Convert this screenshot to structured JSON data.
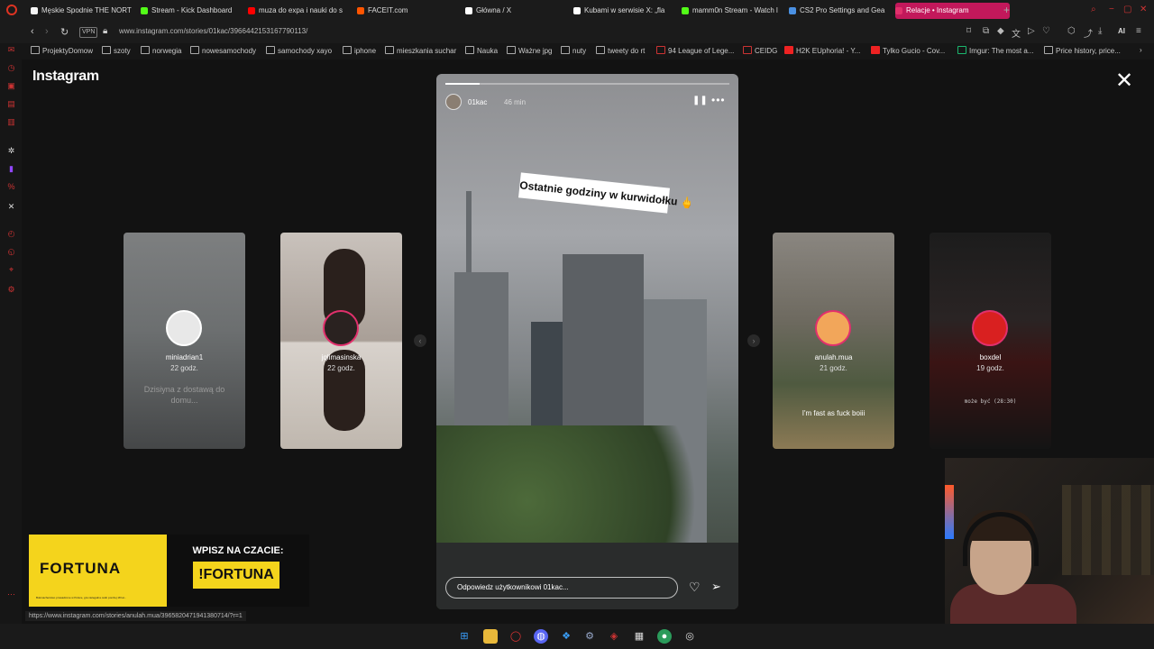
{
  "browser": {
    "tabs": [
      {
        "label": "Męskie Spodnie THE NORT",
        "color": "#f5f5f5"
      },
      {
        "label": "Stream - Kick Dashboard",
        "color": "#53fc18"
      },
      {
        "label": "muza do expa i nauki do s",
        "color": "#ff0000"
      },
      {
        "label": "FACEIT.com",
        "color": "#ff5500"
      },
      {
        "label": "Główna / X",
        "color": "#ffffff"
      },
      {
        "label": "Kubami w serwisie X: „fla",
        "color": "#ffffff"
      },
      {
        "label": "mamm0n Stream - Watch l",
        "color": "#53fc18"
      },
      {
        "label": "CS2 Pro Settings and Gea",
        "color": "#4a90e2"
      },
      {
        "label": "Relacje • Instagram",
        "color": "#e1306c"
      }
    ],
    "new_tab": "+",
    "url": "www.instagram.com/stories/01kac/3966442153167790113/",
    "vpn": "VPN",
    "ai": "AI",
    "bookmarks": [
      "ProjektyDomow",
      "szoty",
      "norwegia",
      "nowesamochody",
      "samochody xayo",
      "iphone",
      "mieszkania suchar",
      "Nauka",
      "Ważne jpg",
      "nuty",
      "tweety do rt",
      "94 League of Lege...",
      "CEIDG",
      "H2K EUphoria! - Y...",
      "Tylko Gucio - Cov...",
      "Imgur: The most a...",
      "Price history, price..."
    ]
  },
  "instagram": {
    "logo": "Instagram",
    "story": {
      "username": "01kac",
      "time": "46 min",
      "sticker_text": "Ostatnie godziny w kurwidołku 🖕",
      "reply_placeholder": "Odpowiedz użytkownikowi 01kac...",
      "progress": 0.12
    },
    "previews": [
      {
        "name": "miniadrian1",
        "time": "22 godz.",
        "caption": "Dzisiyna z dostawą do domu...",
        "avatar_color": "#e8e8e8"
      },
      {
        "name": "jqlimasinska",
        "time": "22 godz.",
        "caption": "",
        "avatar_color": "#2a2220"
      },
      {
        "name": "anulah.mua",
        "time": "21 godz.",
        "caption": "I'm fast as fuck boiii",
        "avatar_color": "#f2a65a"
      },
      {
        "name": "boxdel",
        "time": "19 godz.",
        "caption": "może być (28:30)",
        "avatar_color": "#d92020"
      }
    ]
  },
  "overlay": {
    "brand": "FORTUNA",
    "banner_title": "WPISZ NA CZACIE:",
    "banner_command": "!FORTUNA",
    "small_print": "Bukmacherstwo prowadzone w Polsce, gra nielegalna osób poniżej 18 lat..."
  },
  "status_url": "https://www.instagram.com/stories/anulah.mua/3965820471941380714/?r=1",
  "colors": {
    "accent": "#c2185b",
    "fortuna_yellow": "#f4d41c"
  }
}
